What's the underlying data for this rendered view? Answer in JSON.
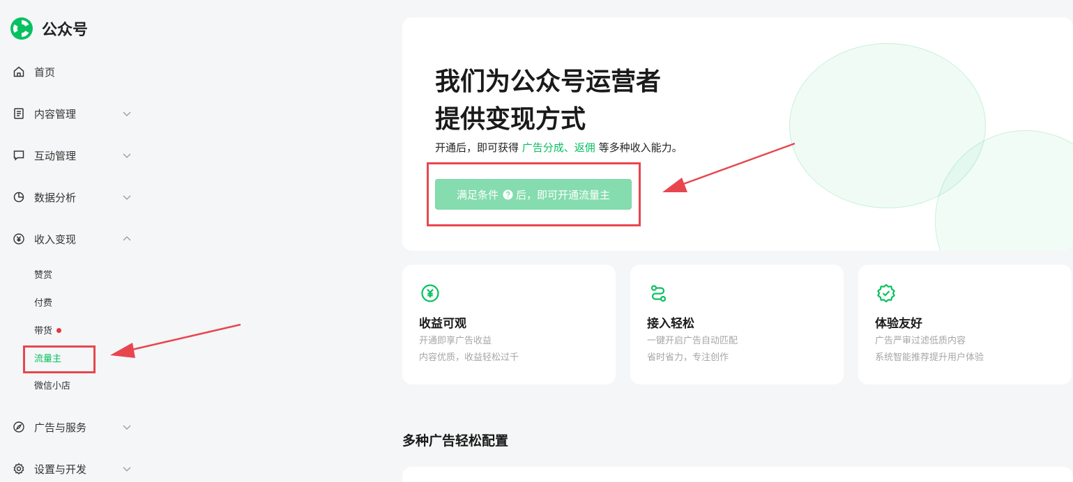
{
  "brand": {
    "name": "公众号",
    "logo_icon": "wechat-mp-logo-icon",
    "color": "#07c160"
  },
  "sidebar": {
    "items": [
      {
        "label": "首页",
        "icon": "home-icon"
      },
      {
        "label": "内容管理",
        "icon": "document-icon"
      },
      {
        "label": "互动管理",
        "icon": "message-icon"
      },
      {
        "label": "数据分析",
        "icon": "pie-chart-icon"
      },
      {
        "label": "收入变现",
        "icon": "yuan-circle-icon",
        "expanded": true
      },
      {
        "label": "广告与服务",
        "icon": "compass-icon"
      },
      {
        "label": "设置与开发",
        "icon": "gear-icon"
      }
    ],
    "sub_items": [
      {
        "label": "赞赏"
      },
      {
        "label": "付费"
      },
      {
        "label": "带货",
        "dot": true
      },
      {
        "label": "流量主",
        "active": true
      },
      {
        "label": "微信小店"
      }
    ]
  },
  "hero": {
    "title_line1": "我们为公众号运营者",
    "title_line2": "提供变现方式",
    "desc_prefix": "开通后，即可获得",
    "desc_highlight": "广告分成、返佣",
    "desc_suffix": "等多种收入能力。",
    "button_prefix": "满足条件",
    "button_suffix": "后，即可开通流量主"
  },
  "features": [
    {
      "icon": "yuan-circle-icon",
      "title": "收益可观",
      "line1": "开通即享广告收益",
      "line2": "内容优质，收益轻松过千"
    },
    {
      "icon": "route-icon",
      "title": "接入轻松",
      "line1": "一键开启广告自动匹配",
      "line2": "省时省力，专注创作"
    },
    {
      "icon": "verified-badge-icon",
      "title": "体验友好",
      "line1": "广告严审过滤低质内容",
      "line2": "系统智能推荐提升用户体验"
    }
  ],
  "section": {
    "title": "多种广告轻松配置"
  },
  "colors": {
    "accent": "#07c160",
    "annotation": "#e8464e",
    "button": "#85dcae"
  }
}
